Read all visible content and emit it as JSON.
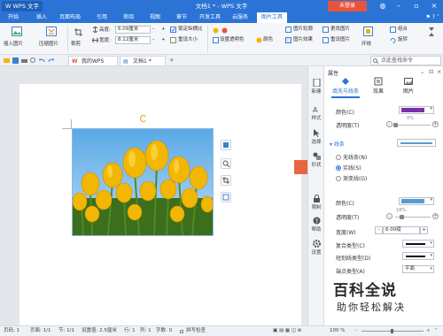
{
  "titlebar": {
    "app_menu": "W WPS 文字",
    "doc_title": "文档1 * - WPS 文字",
    "login": "未登录",
    "colors": {
      "bar": "#2b74d6",
      "login": "#e8543a"
    }
  },
  "ribbon_tabs": [
    "开始",
    "插入",
    "页面布局",
    "引用",
    "审阅",
    "视图",
    "章节",
    "开发工具",
    "云服务",
    "图片工具"
  ],
  "ribbon": {
    "insert_picture": "插入图片",
    "compress_picture": "压缩图片",
    "crop": "裁剪",
    "height_label": "高度:",
    "height_value": "6.09厘米",
    "width_label": "宽度:",
    "width_value": "8.12厘米",
    "lock_ratio": "锁定纵横比",
    "reset_size": "重设大小",
    "set_transparent": "设置透明色",
    "color": "颜色",
    "picture_outline": "图片轮廓",
    "picture_effect": "图片效果",
    "change_picture": "更改图片",
    "reset_picture": "重设图片",
    "wrap": "环绕",
    "combine": "组合",
    "rotate": "旋转"
  },
  "qbar": {
    "tabs": [
      "我的WPS",
      "文档1 *"
    ],
    "search_placeholder": "点此查找命令"
  },
  "vstrip": [
    "新建",
    "样式",
    "选择",
    "形状",
    "限制",
    "帮助",
    "设置"
  ],
  "panel": {
    "title": "属性",
    "tabs": [
      "填充与线条",
      "效果",
      "图片"
    ],
    "fill_color_label": "颜色(C)",
    "fill_color": "#7b2fa6",
    "transparency_label": "透明度(T)",
    "transparency_value": "0%",
    "line_section": "线条",
    "line_options": [
      "无线条(N)",
      "实线(S)",
      "渐变线(G)"
    ],
    "line_selected": 1,
    "line_color_label": "颜色(C)",
    "line_color": "#5b9bd5",
    "line_transparency_label": "透明度(T)",
    "line_transparency_value": "18%",
    "width_label": "宽度(W)",
    "width_value": "6.00磅",
    "compound_label": "复合类型(C)",
    "dash_label": "短划线类型(D)",
    "endpoint_label": "端点类型(A)",
    "endpoint_value": "平面"
  },
  "statusbar": {
    "page": "页码: 1",
    "pages": "页面: 1/1",
    "section": "节: 1/1",
    "setting": "设置值: 2.5厘米",
    "row": "行: 1",
    "col": "列: 1",
    "words": "字数: 0",
    "spell": "拼写检查",
    "zoom": "100 %"
  },
  "watermark": {
    "big": "百科全说",
    "small": "助你轻松解决"
  }
}
